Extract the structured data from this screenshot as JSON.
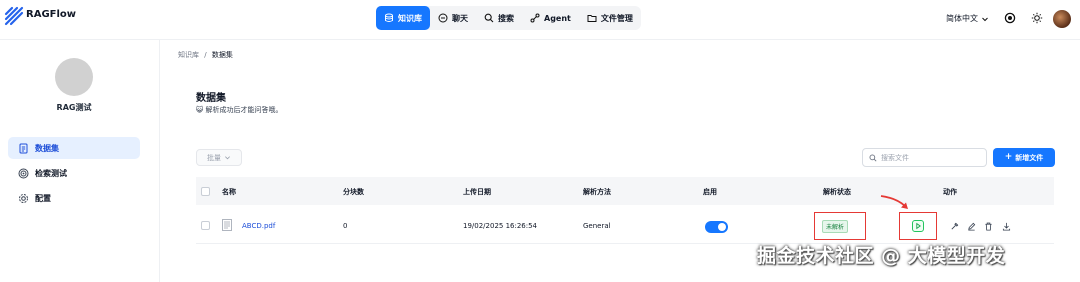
{
  "app": {
    "name": "RAGFlow"
  },
  "nav": {
    "items": [
      {
        "label": "知识库",
        "icon": "database-icon",
        "active": true
      },
      {
        "label": "聊天",
        "icon": "chat-icon",
        "active": false
      },
      {
        "label": "搜索",
        "icon": "search-icon",
        "active": false
      },
      {
        "label": "Agent",
        "icon": "agent-icon",
        "active": false
      },
      {
        "label": "文件管理",
        "icon": "folder-icon",
        "active": false
      }
    ],
    "language": "简体中文"
  },
  "sidebar": {
    "dataset_name": "RAG测试",
    "items": [
      {
        "label": "数据集",
        "icon": "document-icon",
        "active": true
      },
      {
        "label": "检索测试",
        "icon": "target-icon",
        "active": false
      },
      {
        "label": "配置",
        "icon": "gear-icon",
        "active": false
      }
    ]
  },
  "breadcrumb": {
    "root": "知识库",
    "separator": "/",
    "current": "数据集"
  },
  "page": {
    "title": "数据集",
    "description": "😺 解析成功后才能问答哦。"
  },
  "toolbar": {
    "bulk_label": "批量",
    "search_placeholder": "搜索文件",
    "new_file_label": "新增文件"
  },
  "table": {
    "columns": [
      "名称",
      "分块数",
      "上传日期",
      "解析方法",
      "启用",
      "解析状态",
      "动作"
    ],
    "rows": [
      {
        "name": "ABCD.pdf",
        "chunks": "0",
        "upload_date": "19/02/2025 16:26:54",
        "parse_method": "General",
        "enabled": true,
        "status": "未解析"
      }
    ]
  },
  "watermark": "掘金技术社区 @ 大模型开发",
  "colors": {
    "accent": "#1677ff",
    "annotation": "#e53935",
    "status_green": "#15803d"
  }
}
